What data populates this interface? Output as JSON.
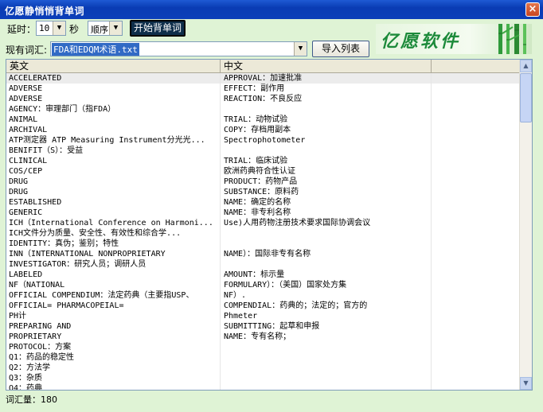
{
  "window": {
    "title": "亿愿静悄悄背单词",
    "close_glyph": "×"
  },
  "toolbar": {
    "delay_label": "延时：",
    "delay_value": "10",
    "seconds_label": "秒",
    "order_value": "顺序",
    "start_button": "开始背单词",
    "current_vocab_label": "现有词汇:",
    "file_value": "FDA和EDQM术语.txt",
    "import_button": "导入列表",
    "logo_text": "亿愿软件"
  },
  "table": {
    "columns": [
      "英文",
      "中文"
    ],
    "rows": [
      [
        "ACCELERATED",
        "APPROVAL：加速批准"
      ],
      [
        "ADVERSE",
        "EFFECT：副作用"
      ],
      [
        "ADVERSE",
        "REACTION：不良反应"
      ],
      [
        "AGENCY：审理部门（指FDA）",
        ""
      ],
      [
        "ANIMAL",
        "TRIAL：动物试验"
      ],
      [
        "ARCHIVAL",
        "COPY：存档用副本"
      ],
      [
        "ATP测定器 ATP Measuring Instrument分光光...",
        "Spectrophotometer"
      ],
      [
        "BENIFIT（S）：受益",
        ""
      ],
      [
        "CLINICAL",
        "TRIAL：临床试验"
      ],
      [
        "COS/CEP",
        "欧洲药典符合性认证"
      ],
      [
        "DRUG",
        "PRODUCT：药物产品"
      ],
      [
        "DRUG",
        "SUBSTANCE：原料药"
      ],
      [
        "ESTABLISHED",
        "NAME：确定的名称"
      ],
      [
        "GENERIC",
        "NAME：非专利名称"
      ],
      [
        "ICH（International Conference on Harmoni...",
        "Use)人用药物注册技术要求国际协调会议"
      ],
      [
        "ICH文件分为质量、安全性、有效性和综合学...",
        ""
      ],
      [
        "IDENTITY：真伪；鉴别；特性",
        ""
      ],
      [
        "INN（INTERNATIONAL NONPROPRIETARY",
        "NAME）：国际非专有名称"
      ],
      [
        "INVESTIGATOR：研究人员；调研人员",
        ""
      ],
      [
        "LABELED",
        "AMOUNT：标示量"
      ],
      [
        "NF（NATIONAL",
        "FORMULARY）：（美国）国家处方集"
      ],
      [
        "OFFICIAL COMPENDIUM：法定药典（主要指USP、",
        "NF）."
      ],
      [
        "OFFICIAL= PHARMACOPEIAL=",
        "COMPENDIAL：药典的；法定的；官方的"
      ],
      [
        "PH计",
        "Phmeter"
      ],
      [
        "PREPARING AND",
        "SUBMITTING：起草和申报"
      ],
      [
        "PROPRIETARY",
        "NAME：专有名称；"
      ],
      [
        "PROTOCOL：方案",
        ""
      ],
      [
        "Q1：药品的稳定性",
        ""
      ],
      [
        "Q2：方法学",
        ""
      ],
      [
        "Q3：杂质",
        ""
      ],
      [
        "Q4：药典",
        ""
      ]
    ]
  },
  "status": {
    "vocab_count": "词汇量：180"
  }
}
